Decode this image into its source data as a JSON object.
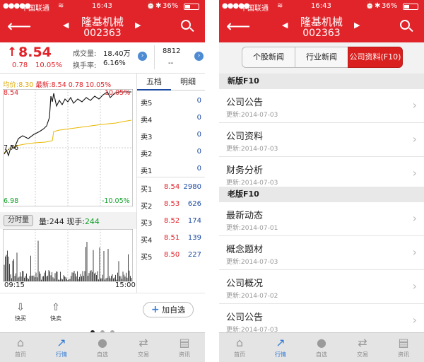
{
  "status_bar": {
    "signal": "●●●●●",
    "carrier": "中国联通",
    "wifi": "≋",
    "time": "16:43",
    "alarm": "⏰",
    "bluetooth": "✱",
    "battery": "36%"
  },
  "nav": {
    "title": "隆基机械",
    "code": "002363",
    "prev": "◀",
    "next": "▶"
  },
  "quote": {
    "price": "8.54",
    "change": "0.78",
    "change_pct": "10.05%",
    "volume_label": "成交量:",
    "volume_value": "18.40万",
    "turnover_label": "换手率:",
    "turnover_value": "6.16%",
    "right_value": "8812",
    "right_sub": "--"
  },
  "chart": {
    "avg_label": "均价:",
    "avg_value": "8.30",
    "latest_label": "最新:",
    "latest_value": "8.54",
    "latest_change": "0.78",
    "latest_pct": "10.05%",
    "y_top": "8.54",
    "y_mid": "7.76",
    "y_bottom": "6.98",
    "pct_top": "10.05%",
    "pct_bottom": "-10.05%"
  },
  "volume": {
    "button": "分时量",
    "volume_label": "量:",
    "volume_value": "244",
    "now_label": "现手:",
    "now_value": "244",
    "time_start": "09:15",
    "time_end": "15:00"
  },
  "orderbook": {
    "tabs": [
      "五档",
      "明细"
    ],
    "sells": [
      {
        "label": "卖5",
        "price": "",
        "vol": "0"
      },
      {
        "label": "卖4",
        "price": "",
        "vol": "0"
      },
      {
        "label": "卖3",
        "price": "",
        "vol": "0"
      },
      {
        "label": "卖2",
        "price": "",
        "vol": "0"
      },
      {
        "label": "卖1",
        "price": "",
        "vol": "0"
      }
    ],
    "buys": [
      {
        "label": "买1",
        "price": "8.54",
        "vol": "2980"
      },
      {
        "label": "买2",
        "price": "8.53",
        "vol": "626"
      },
      {
        "label": "买3",
        "price": "8.52",
        "vol": "174"
      },
      {
        "label": "买4",
        "price": "8.51",
        "vol": "139"
      },
      {
        "label": "买5",
        "price": "8.50",
        "vol": "227"
      }
    ]
  },
  "toolbar": {
    "quick_buy": "快买",
    "quick_sell": "快卖",
    "add_watch": "加自选"
  },
  "tabbar": [
    "首页",
    "行情",
    "自选",
    "交易",
    "资讯"
  ],
  "right": {
    "segments": [
      "个股新闻",
      "行业新闻",
      "公司资料(F10)"
    ],
    "sections": [
      {
        "title": "新版F10",
        "items": [
          {
            "title": "公司公告",
            "date": "更新:2014-07-03"
          },
          {
            "title": "公司资料",
            "date": "更新:2014-07-03"
          },
          {
            "title": "财务分析",
            "date": "更新:2014-07-03"
          }
        ]
      },
      {
        "title": "老版F10",
        "items": [
          {
            "title": "最新动态",
            "date": "更新:2014-07-01"
          },
          {
            "title": "概念题材",
            "date": "更新:2014-07-03"
          },
          {
            "title": "公司概况",
            "date": "更新:2014-07-02"
          },
          {
            "title": "公司公告",
            "date": "更新:2014-07-03"
          }
        ]
      }
    ]
  },
  "colors": {
    "brand_red": "#e1232a",
    "green": "#12a12a",
    "blue": "#1c4aa3",
    "accent": "#2f7ad6"
  }
}
